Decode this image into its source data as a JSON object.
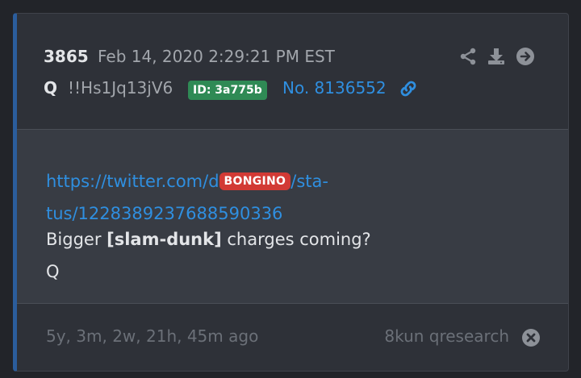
{
  "post": {
    "number": "3865",
    "timestamp": "Feb 14, 2020 2:29:21 PM EST",
    "author": "Q",
    "tripcode": "!!Hs1Jq13jV6",
    "id_badge": "ID: 3a775b",
    "post_no": "No. 8136552"
  },
  "body": {
    "link_part1": "https://twitter.com/d",
    "link_redacted": "BONGINO",
    "link_part2": "/sta-",
    "link_line2": "tus/1228389237688590336",
    "text_before": "Bigger ",
    "text_bold": "[slam-dunk]",
    "text_after": " charges coming?",
    "signature": "Q"
  },
  "footer": {
    "ago": "5y, 3m, 2w, 21h, 45m ago",
    "board": "8kun qresearch"
  },
  "icons": {
    "share": "share-icon",
    "download": "download-icon",
    "goto": "arrow-circle-right-icon",
    "link": "link-icon",
    "close": "close-circle-icon"
  },
  "colors": {
    "accent_link": "#2f8fe0",
    "id_badge": "#2f8a55",
    "redaction": "#d23a35",
    "left_border": "#2b5d9c"
  }
}
